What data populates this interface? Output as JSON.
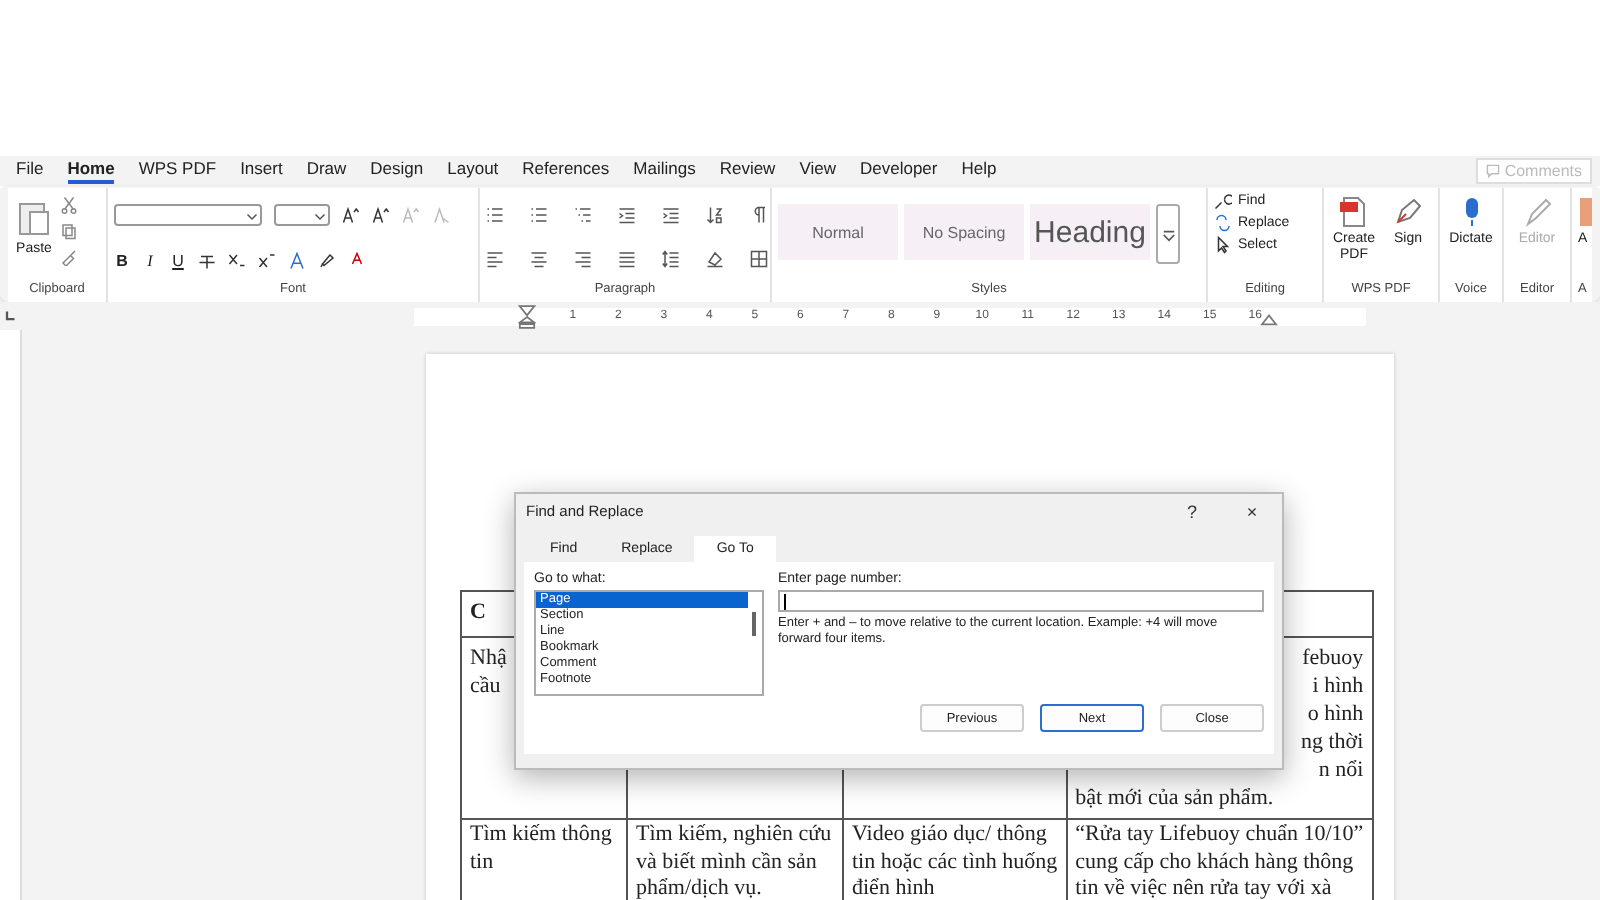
{
  "tabs": [
    {
      "label": "File",
      "selected": false
    },
    {
      "label": "Home",
      "selected": true
    },
    {
      "label": "WPS PDF",
      "selected": false
    },
    {
      "label": "Insert",
      "selected": false
    },
    {
      "label": "Draw",
      "selected": false
    },
    {
      "label": "Design",
      "selected": false
    },
    {
      "label": "Layout",
      "selected": false
    },
    {
      "label": "References",
      "selected": false
    },
    {
      "label": "Mailings",
      "selected": false
    },
    {
      "label": "Review",
      "selected": false
    },
    {
      "label": "View",
      "selected": false
    },
    {
      "label": "Developer",
      "selected": false
    },
    {
      "label": "Help",
      "selected": false
    }
  ],
  "comments_button": {
    "label": "Comments",
    "disabled": true
  },
  "ribbon": {
    "clipboard": {
      "label": "Clipboard",
      "paste": "Paste"
    },
    "font": {
      "label": "Font",
      "bold": "B",
      "italic": "I",
      "underline": "U"
    },
    "paragraph": {
      "label": "Paragraph"
    },
    "styles": {
      "label": "Styles",
      "items": [
        {
          "label": "Normal",
          "kind": "normal"
        },
        {
          "label": "No Spacing",
          "kind": "normal"
        },
        {
          "label": "Heading",
          "kind": "heading"
        }
      ]
    },
    "editing": {
      "label": "Editing",
      "items": [
        {
          "label": "Find",
          "kind": "find"
        },
        {
          "label": "Replace",
          "kind": "replace"
        },
        {
          "label": "Select",
          "kind": "select"
        }
      ]
    },
    "wps": {
      "label": "WPS PDF",
      "items": [
        {
          "label": "Create PDF",
          "kind": "pdf"
        },
        {
          "label": "Sign",
          "kind": "sign"
        }
      ]
    },
    "voice": {
      "label": "Voice",
      "button": "Dictate"
    },
    "editor": {
      "label": "Editor",
      "button": "Editor",
      "disabled": true
    },
    "cut_group": {
      "label": "A",
      "button": "A"
    }
  },
  "ruler": {
    "numbers": [
      "1",
      "2",
      "3",
      "4",
      "5",
      "6",
      "7",
      "8",
      "9",
      "10",
      "11",
      "12",
      "13",
      "14",
      "15",
      "16"
    ]
  },
  "table": {
    "rows": [
      {
        "kind": "header",
        "cells": [
          {
            "lines": [
              {
                "text": "C",
                "kind": "full"
              }
            ]
          },
          {},
          {},
          {}
        ]
      },
      {
        "kind": "body",
        "cells": [
          {
            "lines": [
              {
                "text": "Nhậ",
                "kind": "full"
              },
              {
                "text": "cầu",
                "kind": "full"
              }
            ]
          },
          {},
          {},
          {
            "lines": [
              {
                "text": "febuoy",
                "kind": "tail"
              },
              {
                "text": "i hình",
                "kind": "tail"
              },
              {
                "text": "o hình",
                "kind": "tail"
              },
              {
                "text": "ng thời",
                "kind": "tail"
              },
              {
                "text": "n nổi",
                "kind": "tail"
              },
              {
                "text": "bật mới của sản phẩm.",
                "kind": "full"
              }
            ]
          }
        ]
      },
      {
        "kind": "body",
        "cells": [
          {
            "lines": [
              {
                "text": "Tìm kiếm thông",
                "kind": "full"
              },
              {
                "text": "tin",
                "kind": "full"
              }
            ]
          },
          {
            "lines": [
              {
                "text": "Tìm kiếm, nghiên cứu",
                "kind": "full"
              },
              {
                "text": "và biết mình cần sản",
                "kind": "full"
              },
              {
                "text": "phẩm/dịch vụ.",
                "kind": "full"
              }
            ]
          },
          {
            "lines": [
              {
                "text": "Video giáo dục/ thông",
                "kind": "full"
              },
              {
                "text": "tin hoặc các tình huống",
                "kind": "full"
              },
              {
                "text": "điển hình",
                "kind": "full"
              }
            ]
          },
          {
            "lines": [
              {
                "text": "“Rửa tay Lifebuoy chuẩn 10/10”",
                "kind": "full"
              },
              {
                "text": "cung cấp cho khách hàng thông",
                "kind": "full"
              },
              {
                "text": "tin về việc nên rửa tay với xà",
                "kind": "full"
              }
            ]
          }
        ]
      }
    ]
  },
  "dialog": {
    "title": "Find and Replace",
    "help": "?",
    "close": "×",
    "tabs": [
      {
        "label": "Find",
        "selected": false
      },
      {
        "label": "Replace",
        "selected": false
      },
      {
        "label": "Go To",
        "selected": true
      }
    ],
    "goto_label": "Go to what:",
    "goto_items": [
      {
        "label": "Page",
        "selected": true
      },
      {
        "label": "Section",
        "selected": false
      },
      {
        "label": "Line",
        "selected": false
      },
      {
        "label": "Bookmark",
        "selected": false
      },
      {
        "label": "Comment",
        "selected": false
      },
      {
        "label": "Footnote",
        "selected": false
      }
    ],
    "input_label": "Enter page number:",
    "hint": "Enter + and – to move relative to the current location. Example: +4 will move forward four items.",
    "buttons": [
      {
        "label": "Previous",
        "default": false
      },
      {
        "label": "Next",
        "default": true
      },
      {
        "label": "Close",
        "default": false
      }
    ]
  }
}
